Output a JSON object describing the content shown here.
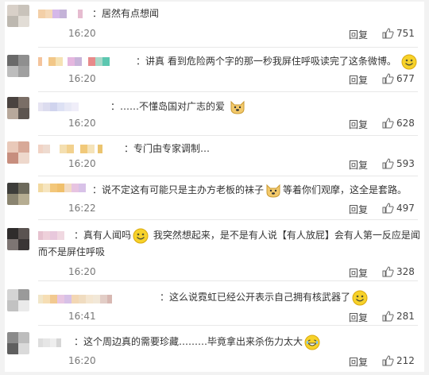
{
  "comments": [
    {
      "text_before": "：居然有点想闻",
      "emoji": "",
      "text_after": "",
      "line2": "",
      "time": "16:20",
      "reply": "回复",
      "likes": "751"
    },
    {
      "text_before": "：讲真   看到危险两个字的那一秒我屏住呼吸读完了这条微博。",
      "emoji": "smile",
      "text_after": "",
      "line2": "",
      "time": "16:20",
      "reply": "回复",
      "likes": "677"
    },
    {
      "text_before": "：……不懂岛国对广志的爱",
      "emoji": "doge",
      "text_after": "",
      "line2": "",
      "time": "16:20",
      "reply": "回复",
      "likes": "628"
    },
    {
      "text_before": "：专门由专家调制…",
      "emoji": "",
      "text_after": "",
      "line2": "",
      "time": "16:20",
      "reply": "回复",
      "likes": "593"
    },
    {
      "text_before": "：说不定这有可能只是主办方老板的袜子",
      "emoji": "doge",
      "text_after": "等着你们观摩，这全是套路。",
      "line2": "",
      "time": "16:22",
      "reply": "回复",
      "likes": "497"
    },
    {
      "text_before": "：真有人闻吗",
      "emoji": "smile",
      "text_after": " 我突然想起来，是不是有人说【有人放屁】会有人第一反应是闻",
      "line2": "而不是屏住呼吸",
      "time": "16:20",
      "reply": "回复",
      "likes": "328"
    },
    {
      "text_before": "：这么说霓虹已经公开表示自己拥有核武器了",
      "emoji": "smile",
      "text_after": "",
      "line2": "",
      "time": "16:41",
      "reply": "回复",
      "likes": "281"
    },
    {
      "text_before": "：这个周边真的需要珍藏………毕竟拿出来杀伤力太大",
      "emoji": "laugh",
      "text_after": "",
      "line2": "",
      "time": "16:20",
      "reply": "回复",
      "likes": "212"
    }
  ],
  "colors": {
    "text": "#333333",
    "meta": "#777777",
    "emoji": "#f5c518"
  }
}
